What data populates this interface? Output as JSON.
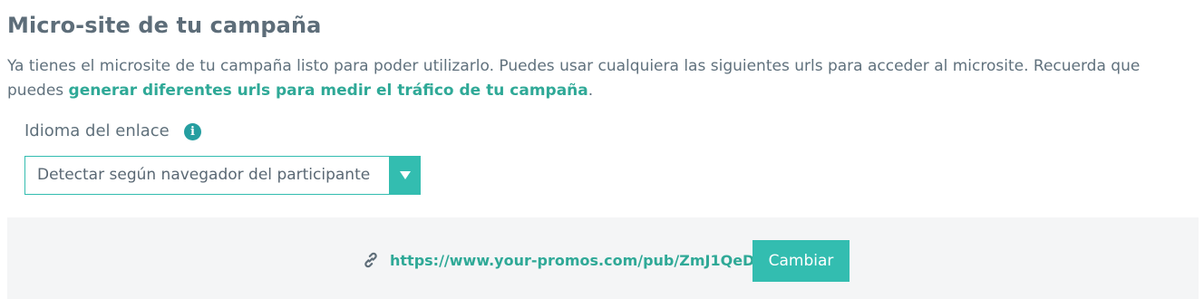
{
  "section": {
    "title": "Micro-site de tu campaña",
    "description_text": "Ya tienes el microsite de tu campaña listo para poder utilizarlo. Puedes usar cualquiera las siguientes urls para acceder al microsite. Recuerda que puedes ",
    "description_link": "generar diferentes urls para medir el tráfico de tu campaña",
    "description_end": "."
  },
  "language": {
    "label": "Idioma del enlace",
    "info_icon": "info-icon",
    "selected": "Detectar según navegador del participante",
    "dropdown_icon": "caret-down-icon"
  },
  "url_panel": {
    "icon": "link-icon",
    "url": "https://www.your-promos.com/pub/ZmJ1QeD",
    "button_label": "Cambiar"
  },
  "colors": {
    "accent": "#33bdb0",
    "link": "#2fa997",
    "info_icon": "#259ea0",
    "text": "#60717d",
    "panel_bg": "#f4f5f6"
  }
}
